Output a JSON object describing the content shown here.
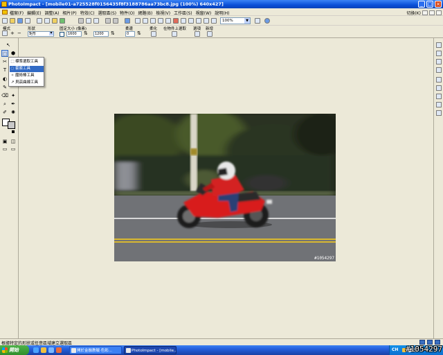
{
  "window": {
    "title": "PhotoImpact - [mobile01-a725528f0156435f8f3188786aa73bc8.jpg (100%) 640x427]",
    "minimize": "_",
    "maximize": "□",
    "close": "×"
  },
  "menu": {
    "items": [
      "檔案(F)",
      "編輯(E)",
      "調整(A)",
      "相片(P)",
      "特效(C)",
      "選取區(S)",
      "物件(O)",
      "網路(B)",
      "檢視(V)",
      "工作區(S)",
      "視窗(W)",
      "說明(H)"
    ],
    "switch_label": "切換(K)"
  },
  "toolbar": {
    "zoom_value": "100%"
  },
  "properties": {
    "shape_label": "形狀",
    "shape_value": "矩形",
    "fixed_size_label": "固定大小 (像素)",
    "width_value": "1600",
    "height_value": "1200",
    "soften_label": "柔邊",
    "soften_value": "0",
    "antialias_label": "柔化",
    "on_object_label": "在物件上選取",
    "options_label": "選項",
    "new_label": "新增"
  },
  "flyout": {
    "items": [
      {
        "label": "標準選取工具",
        "icon": "marquee-icon"
      },
      {
        "label": "套索工具",
        "icon": "lasso-icon"
      },
      {
        "label": "魔術棒工具",
        "icon": "magic-wand-icon"
      },
      {
        "label": "貝茲曲線工具",
        "icon": "bezier-icon"
      }
    ],
    "selected_index": 1
  },
  "canvas": {
    "watermark": "#1054297"
  },
  "status": {
    "text": "根據特定的形狀或任意區域建立選取區"
  },
  "taskbar": {
    "start_label": "開始",
    "tasks": [
      {
        "label": "開於金融教戰·色彩...",
        "active": false
      },
      {
        "label": "PhotoImpact - [mobile...",
        "active": true
      }
    ],
    "lang": "CH"
  },
  "forum_watermark": "#1054297",
  "colors": {
    "title_bar": "#0a50d8",
    "selection": "#316ac5",
    "workspace": "#ece9d8",
    "taskbar": "#245edb",
    "start_button": "#2f8e2c"
  }
}
